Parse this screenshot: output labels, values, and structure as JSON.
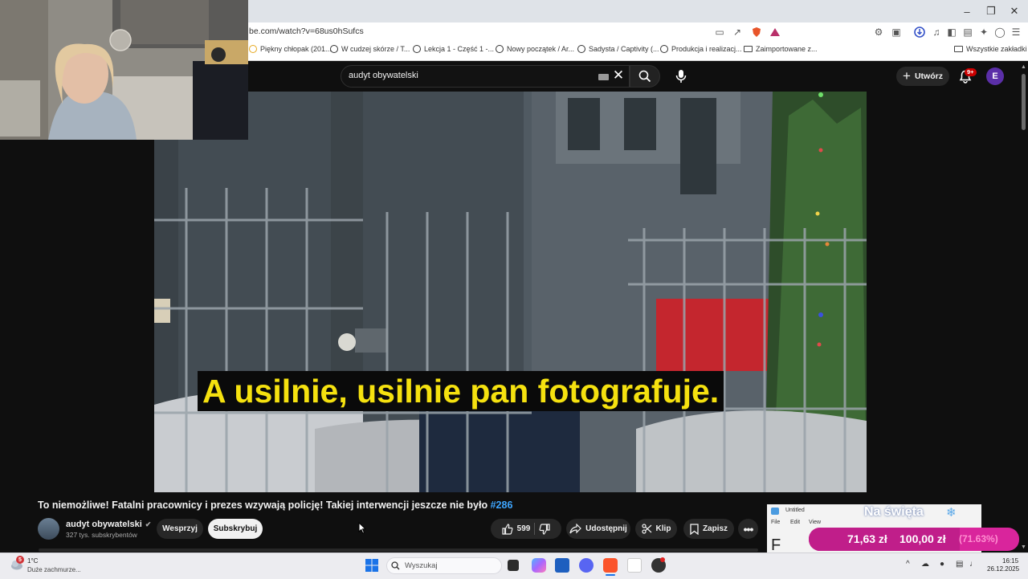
{
  "browser": {
    "url": "be.com/watch?v=68us0hSufcs",
    "bookmarks": [
      {
        "label": "Piękny chłopak (201..."
      },
      {
        "label": "W cudzej skórze / T..."
      },
      {
        "label": "Lekcja 1 - Część 1 -..."
      },
      {
        "label": "Nowy początek / Ar..."
      },
      {
        "label": "Sadysta / Captivity (..."
      },
      {
        "label": "Produkcja i realizacj..."
      },
      {
        "label": "Zaimportowane z..."
      }
    ],
    "all_bookmarks_label": "Wszystkie zakładki"
  },
  "youtube": {
    "search_query": "audyt obywatelski",
    "create_label": "Utwórz",
    "notifications_badge": "9+",
    "avatar_letter": "E"
  },
  "video": {
    "caption": "A usilnie, usilnie pan fotografuje.",
    "title": "To niemożliwe! Fatalni pracownicy i prezes wzywają policję! Takiej interwencji jeszcze nie było",
    "hashtag": "#286",
    "channel_name": "audyt obywatelski",
    "subscribers": "327 tys. subskrybentów",
    "support_label": "Wesprzyj",
    "subscribe_label": "Subskrybuj",
    "likes": "599",
    "share_label": "Udostępnij",
    "clip_label": "Klip",
    "save_label": "Zapisz"
  },
  "overlay": {
    "popup_title": "Untitled",
    "popup_menu": [
      "File",
      "Edit",
      "View"
    ],
    "popup_letter": "F",
    "holiday_text": "Na święta",
    "goal_current": "71,63 zł",
    "goal_target": "100,00 zł",
    "goal_percent_text": "(71.63%)",
    "goal_progress": 0.7163
  },
  "taskbar": {
    "weather_badge": "5",
    "temperature": "1°C",
    "weather_desc": "Duże zachmurze...",
    "search_placeholder": "Wyszukaj",
    "time": "16:15",
    "date": "26.12.2025"
  },
  "colors": {
    "caption_text": "#f5e10f",
    "youtube_bg": "#0f0f0f",
    "hashtag": "#3ea6ff",
    "goal_bar": "#d9259c"
  }
}
